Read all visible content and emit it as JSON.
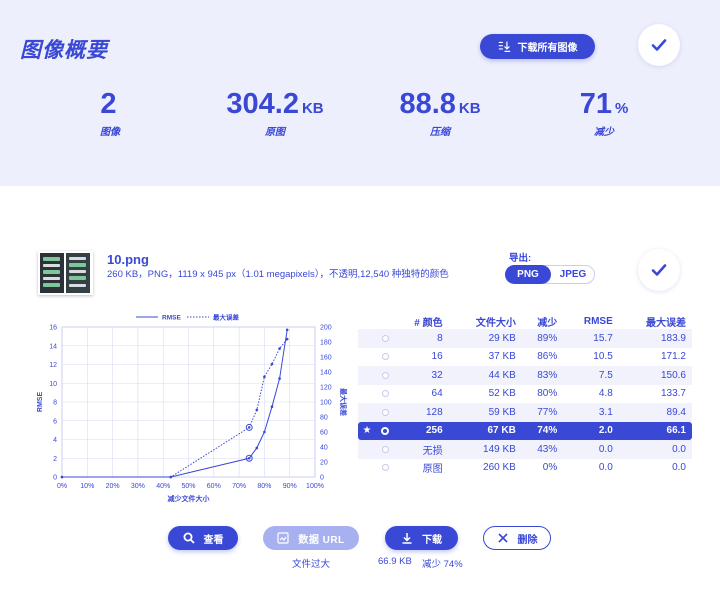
{
  "summary": {
    "title": "图像概要",
    "download_all_label": "下载所有图像",
    "stats": [
      {
        "value": "2",
        "unit": "",
        "label": "图像"
      },
      {
        "value": "304.2",
        "unit": "KB",
        "label": "原图"
      },
      {
        "value": "88.8",
        "unit": "KB",
        "label": "压缩"
      },
      {
        "value": "71",
        "unit": "%",
        "label": "减少"
      }
    ]
  },
  "file": {
    "name": "10.png",
    "info": "260 KB，PNG，1119 x 945 px（1.01 megapixels），不透明,12,540 种独特的颜色",
    "export_label": "导出:",
    "export_options": [
      "PNG",
      "JPEG"
    ],
    "export_selected": "PNG"
  },
  "chart_data": {
    "type": "line",
    "xlabel": "减少文件大小",
    "ylabel": "RMSE",
    "y2label": "最大误差",
    "xlim": [
      0,
      100
    ],
    "ylim": [
      0,
      16
    ],
    "y2lim": [
      0,
      200
    ],
    "x_ticks": [
      "0%",
      "10%",
      "20%",
      "30%",
      "40%",
      "50%",
      "60%",
      "70%",
      "80%",
      "90%",
      "100%"
    ],
    "y_ticks": [
      "0",
      "2",
      "4",
      "6",
      "8",
      "10",
      "12",
      "14",
      "16"
    ],
    "y2_ticks": [
      "0",
      "20",
      "40",
      "60",
      "80",
      "100",
      "120",
      "140",
      "160",
      "180",
      "200"
    ],
    "legend": [
      "RMSE",
      "最大误差"
    ],
    "legend_position": "top",
    "grid": true,
    "series": [
      {
        "name": "RMSE",
        "axis": "left",
        "style": "solid",
        "x": [
          0,
          43,
          74,
          77,
          80,
          83,
          86,
          89
        ],
        "y": [
          0,
          0,
          2.0,
          3.1,
          4.8,
          7.5,
          10.5,
          15.7
        ]
      },
      {
        "name": "最大误差",
        "axis": "right",
        "style": "dotted",
        "x": [
          0,
          43,
          74,
          77,
          80,
          83,
          86,
          89
        ],
        "y": [
          0,
          0,
          66.1,
          89.4,
          133.7,
          150.6,
          171.2,
          183.9
        ]
      }
    ],
    "highlighted_x": 74
  },
  "table": {
    "headers": [
      "# 颜色",
      "文件大小",
      "减少",
      "RMSE",
      "最大误差"
    ],
    "rows": [
      {
        "colors": "8",
        "size": "29 KB",
        "reduce": "89%",
        "rmse": "15.7",
        "maxerr": "183.9"
      },
      {
        "colors": "16",
        "size": "37 KB",
        "reduce": "86%",
        "rmse": "10.5",
        "maxerr": "171.2"
      },
      {
        "colors": "32",
        "size": "44 KB",
        "reduce": "83%",
        "rmse": "7.5",
        "maxerr": "150.6"
      },
      {
        "colors": "64",
        "size": "52 KB",
        "reduce": "80%",
        "rmse": "4.8",
        "maxerr": "133.7"
      },
      {
        "colors": "128",
        "size": "59 KB",
        "reduce": "77%",
        "rmse": "3.1",
        "maxerr": "89.4"
      },
      {
        "colors": "256",
        "size": "67 KB",
        "reduce": "74%",
        "rmse": "2.0",
        "maxerr": "66.1",
        "selected": true,
        "star": "★"
      },
      {
        "colors": "无损",
        "size": "149 KB",
        "reduce": "43%",
        "rmse": "0.0",
        "maxerr": "0.0"
      },
      {
        "colors": "原图",
        "size": "260 KB",
        "reduce": "0%",
        "rmse": "0.0",
        "maxerr": "0.0"
      }
    ]
  },
  "actions": {
    "view_label": "查看",
    "dataurl_label": "数据 URL",
    "download_label": "下载",
    "delete_label": "删除",
    "dataurl_note": "文件过大",
    "download_size": "66.9 KB",
    "download_reduce": "减少 74%"
  },
  "colors": {
    "accent": "#3a48d6",
    "accent_light": "#a8b1f0",
    "panel_bg": "#eeeffc"
  }
}
